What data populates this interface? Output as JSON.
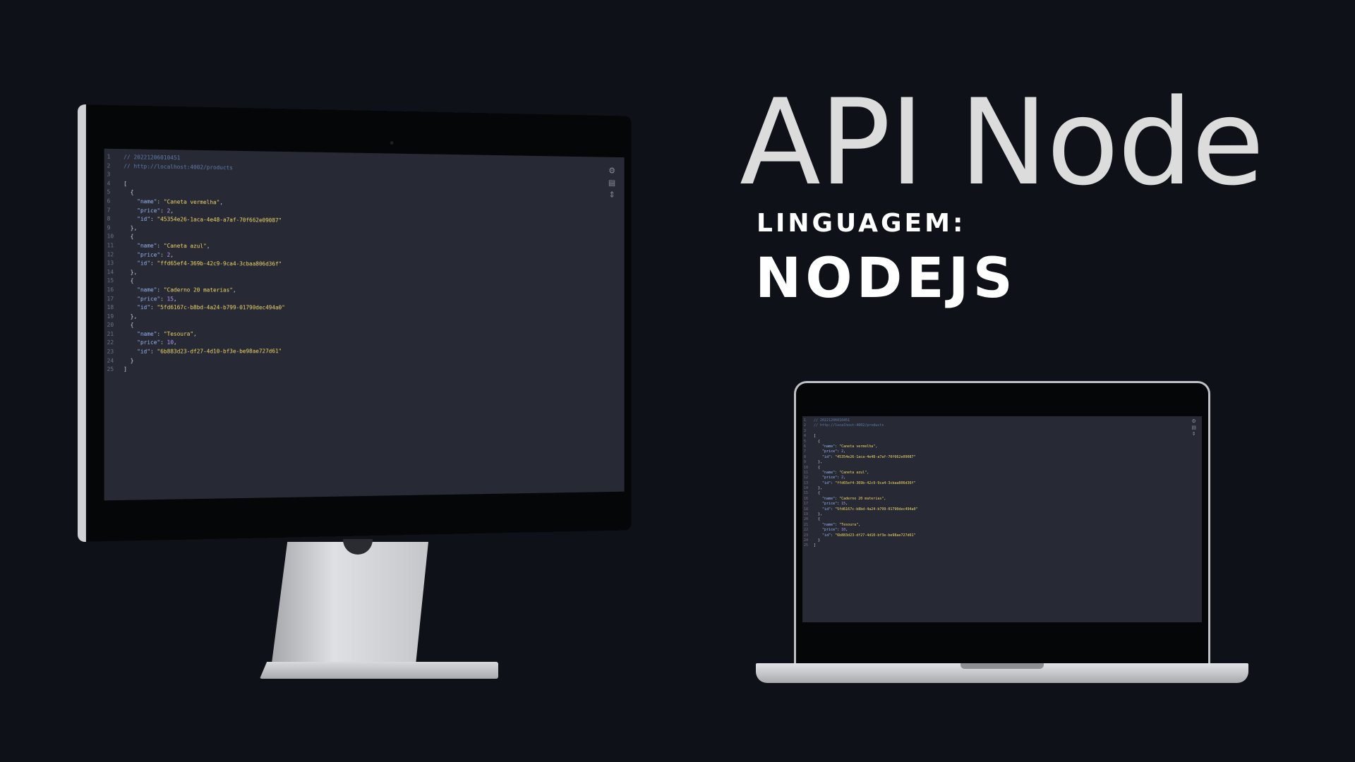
{
  "title": "API Node",
  "language_label": "LINGUAGEM:",
  "language_value": "NODEJS",
  "code": {
    "comment_timestamp": "// 20221206010451",
    "comment_url": "// http://localhost:4002/products",
    "products": [
      {
        "name": "Caneta vermelha",
        "price": "2",
        "id": "45354e26-1aca-4e48-a7af-70f662e09087"
      },
      {
        "name": "Caneta azul",
        "price": "2",
        "id": "ffd65ef4-369b-42c9-9ca4-3cbaa806d36f"
      },
      {
        "name": "Caderno 20 materias",
        "price": "15",
        "id": "5fd6167c-b8bd-4a24-b799-01790dec494a0"
      },
      {
        "name": "Tesoura",
        "price": "10",
        "id": "6b883d23-df27-4d10-bf3e-be98ae727d61"
      }
    ]
  },
  "icons": {
    "settings": "gear-icon",
    "raw": "document-icon",
    "collapse": "chevron-icon"
  },
  "colors": {
    "background": "#0e1118",
    "editor_bg": "#272a35",
    "key": "#9ab4f0",
    "string": "#f1d66a",
    "number": "#b897ff",
    "comment": "#5f7aa8"
  }
}
